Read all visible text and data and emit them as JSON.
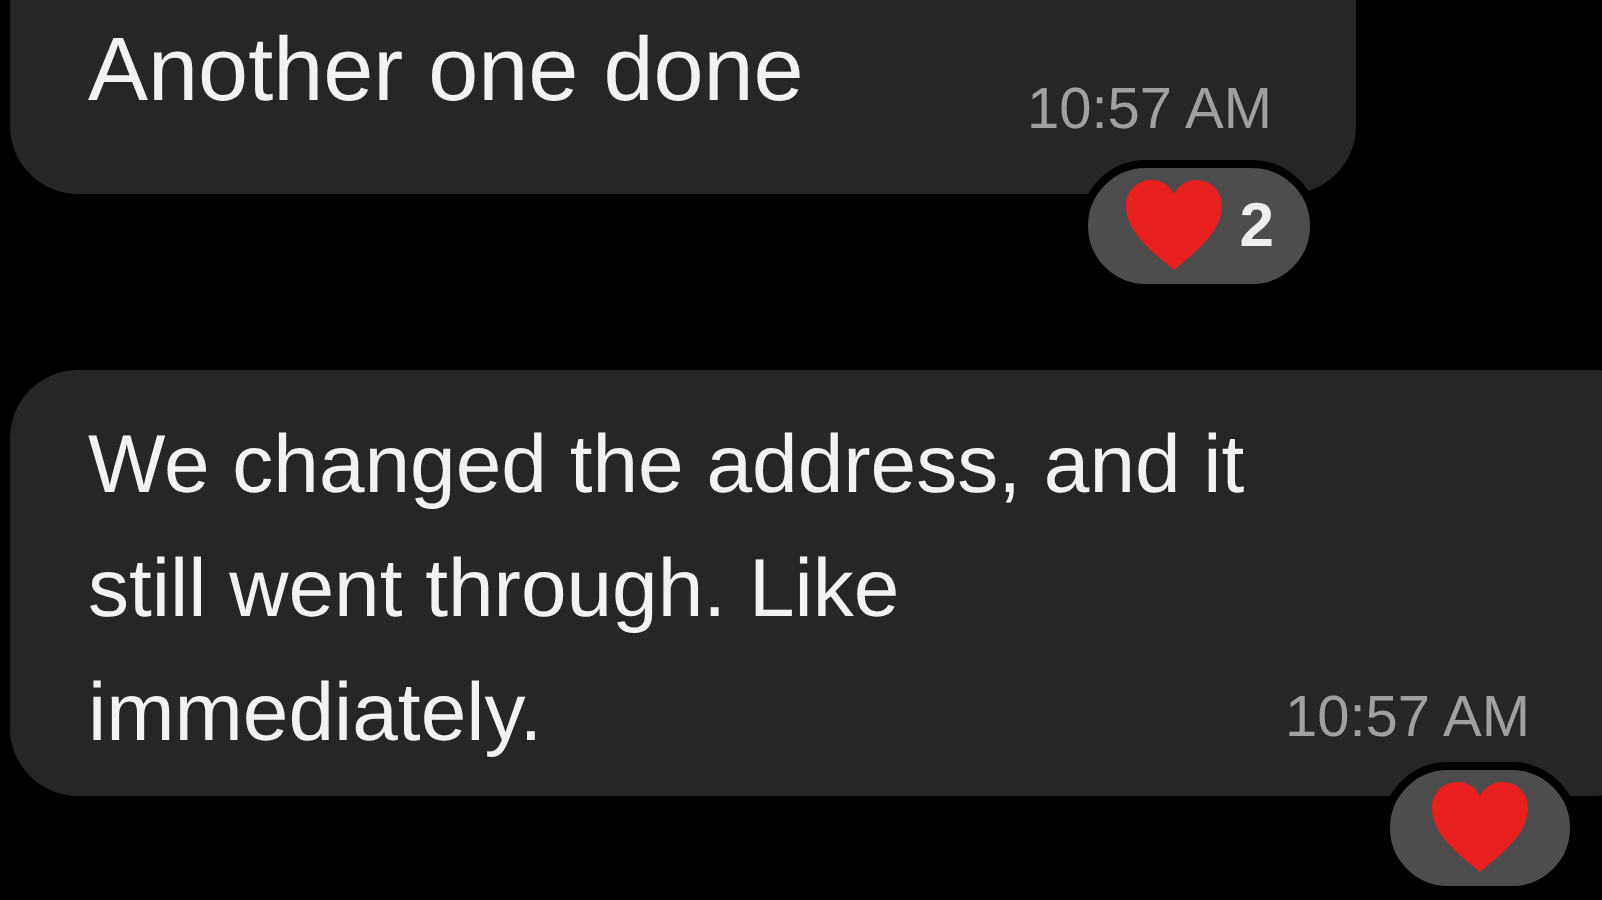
{
  "messages": [
    {
      "text": "Another one done",
      "time": "10:57 AM",
      "reaction": {
        "kind": "heart",
        "count": "2"
      }
    },
    {
      "text": "We changed the address, and it\nstill went through. Like\nimmediately.",
      "time": "10:57 AM",
      "reaction": {
        "kind": "heart"
      }
    }
  ]
}
